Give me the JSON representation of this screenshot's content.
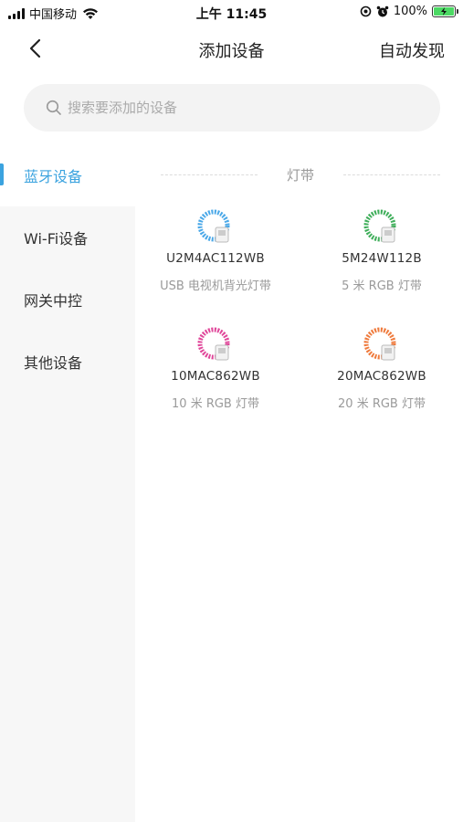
{
  "status_bar": {
    "carrier": "中国移动",
    "time": "上午 11:45",
    "battery": "100%"
  },
  "nav": {
    "title": "添加设备",
    "action_label": "自动发现"
  },
  "search": {
    "placeholder": "搜索要添加的设备",
    "value": ""
  },
  "sidebar": {
    "items": [
      {
        "label": "蓝牙设备",
        "active": true
      },
      {
        "label": "Wi-Fi设备",
        "active": false
      },
      {
        "label": "网关中控",
        "active": false
      },
      {
        "label": "其他设备",
        "active": false
      }
    ]
  },
  "section": {
    "title": "灯带"
  },
  "devices": [
    {
      "model": "U2M4AC112WB",
      "desc": "USB 电视机背光灯带",
      "color": "#4aa8e8"
    },
    {
      "model": "5M24W112B",
      "desc": "5 米 RGB 灯带",
      "color": "#3fae5a"
    },
    {
      "model": "10MAC862WB",
      "desc": "10 米 RGB 灯带",
      "color": "#e0479a"
    },
    {
      "model": "20MAC862WB",
      "desc": "20 米 RGB 灯带",
      "color": "#ef7a3c"
    }
  ],
  "colors": {
    "accent": "#3ba3df"
  }
}
